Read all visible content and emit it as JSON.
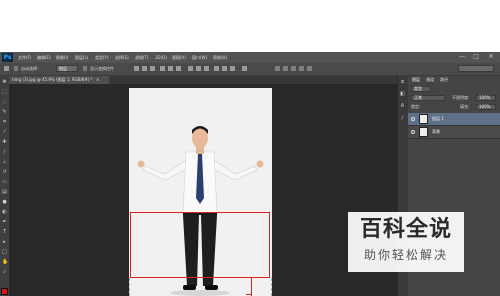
{
  "menubar": {
    "app_logo": "Ps",
    "items": [
      "文件(F)",
      "编辑(E)",
      "图像(I)",
      "图层(L)",
      "类型(Y)",
      "选择(S)",
      "滤镜(T)",
      "3D(D)",
      "视图(V)",
      "窗口(W)",
      "帮助(H)"
    ],
    "controls": [
      "—",
      "□",
      "✕"
    ]
  },
  "options": {
    "auto_select_label": "自动选择：",
    "auto_select_value": "图层",
    "show_transform_label": "显示变换控件"
  },
  "document": {
    "tab_title": "timg (3).jpg @ 45.9% (图层 1, RGB/8#) *",
    "tab_close": "×"
  },
  "panels": {
    "collapsed_icons": [
      "history-icon",
      "adjust-icon",
      "type-icon",
      "brush-icon"
    ],
    "tabs": [
      "图层",
      "通道",
      "路径"
    ],
    "kind_filter": "类型",
    "blend_mode": "正常",
    "opacity_label": "不透明度:",
    "opacity_value": "100%",
    "lock_label": "锁定:",
    "fill_label": "填充:",
    "fill_value": "100%",
    "layers": [
      {
        "name": "图层 1",
        "selected": true
      },
      {
        "name": "背景",
        "selected": false
      }
    ]
  },
  "watermark": {
    "title": "百科全说",
    "subtitle": "助你轻松解决"
  },
  "colors": {
    "foreground": "#e01010",
    "selection": "#e02020",
    "app_bg": "#282828"
  }
}
